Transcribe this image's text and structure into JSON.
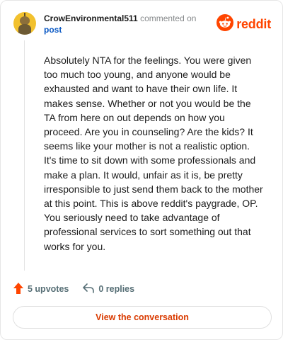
{
  "header": {
    "username": "CrowEnvironmental511",
    "action_text": "commented on",
    "target_link": "post"
  },
  "brand": {
    "wordmark": "reddit",
    "accent_color": "#ff4500",
    "icon": "reddit-snoo-icon"
  },
  "comment": {
    "text": "Absolutely NTA for the feelings. You were given too much too young, and anyone would be exhausted and want to have their own life. It makes sense. Whether or not you would be the TA from here on out depends on how you proceed. Are you in counseling? Are the kids? It seems like your mother is not a realistic option. It's time to sit down with some professionals and make a plan. It would, unfair as it is, be pretty irresponsible to just send them back to the mother at this point. This is above reddit's paygrade, OP. You seriously need to take advantage of professional services to sort something out that works for you."
  },
  "actions": {
    "upvotes_label": "5 upvotes",
    "upvote_icon": "upvote-arrow-icon",
    "replies_label": "0 replies",
    "reply_icon": "reply-icon"
  },
  "cta": {
    "label": "View the conversation"
  }
}
